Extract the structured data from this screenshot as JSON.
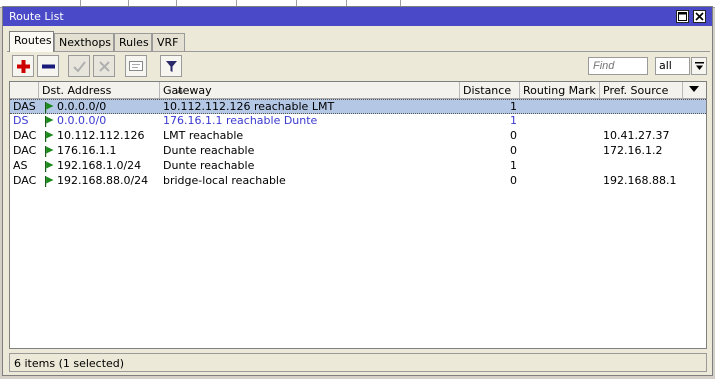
{
  "window": {
    "title": "Route List"
  },
  "tabs": [
    {
      "label": "Routes",
      "active": true
    },
    {
      "label": "Nexthops",
      "active": false
    },
    {
      "label": "Rules",
      "active": false
    },
    {
      "label": "VRF",
      "active": false
    }
  ],
  "toolbar": {
    "find_placeholder": "Find",
    "filter_value": "all",
    "icons": [
      "add-icon",
      "remove-icon",
      "enable-icon",
      "disable-icon",
      "comment-icon",
      "filter-icon"
    ]
  },
  "columns": [
    "",
    "Dst. Address",
    "Gateway",
    "Distance",
    "Routing Mark",
    "Pref. Source"
  ],
  "rows": [
    {
      "flags": "DAS",
      "dst": "0.0.0.0/0",
      "gateway": "10.112.112.126 reachable LMT",
      "distance": "1",
      "mark": "",
      "pref": "",
      "selected": true,
      "blue": false
    },
    {
      "flags": "DS",
      "dst": "0.0.0.0/0",
      "gateway": "176.16.1.1 reachable Dunte",
      "distance": "1",
      "mark": "",
      "pref": "",
      "selected": false,
      "blue": true
    },
    {
      "flags": "DAC",
      "dst": "10.112.112.126",
      "gateway": "LMT reachable",
      "distance": "0",
      "mark": "",
      "pref": "10.41.27.37",
      "selected": false,
      "blue": false
    },
    {
      "flags": "DAC",
      "dst": "176.16.1.1",
      "gateway": "Dunte reachable",
      "distance": "0",
      "mark": "",
      "pref": "172.16.1.2",
      "selected": false,
      "blue": false
    },
    {
      "flags": "AS",
      "dst": "192.168.1.0/24",
      "gateway": "Dunte reachable",
      "distance": "1",
      "mark": "",
      "pref": "",
      "selected": false,
      "blue": false
    },
    {
      "flags": "DAC",
      "dst": "192.168.88.0/24",
      "gateway": "bridge-local reachable",
      "distance": "0",
      "mark": "",
      "pref": "192.168.88.1",
      "selected": false,
      "blue": false
    }
  ],
  "status": "6 items (1 selected)",
  "colors": {
    "titlebar": "#4a4ac8",
    "selection": "#b4c8e6",
    "flag_green": "#1a8a1a",
    "inactive_blue": "#3a3ad0",
    "add_red": "#cc0000",
    "remove_navy": "#1a1a7a"
  }
}
